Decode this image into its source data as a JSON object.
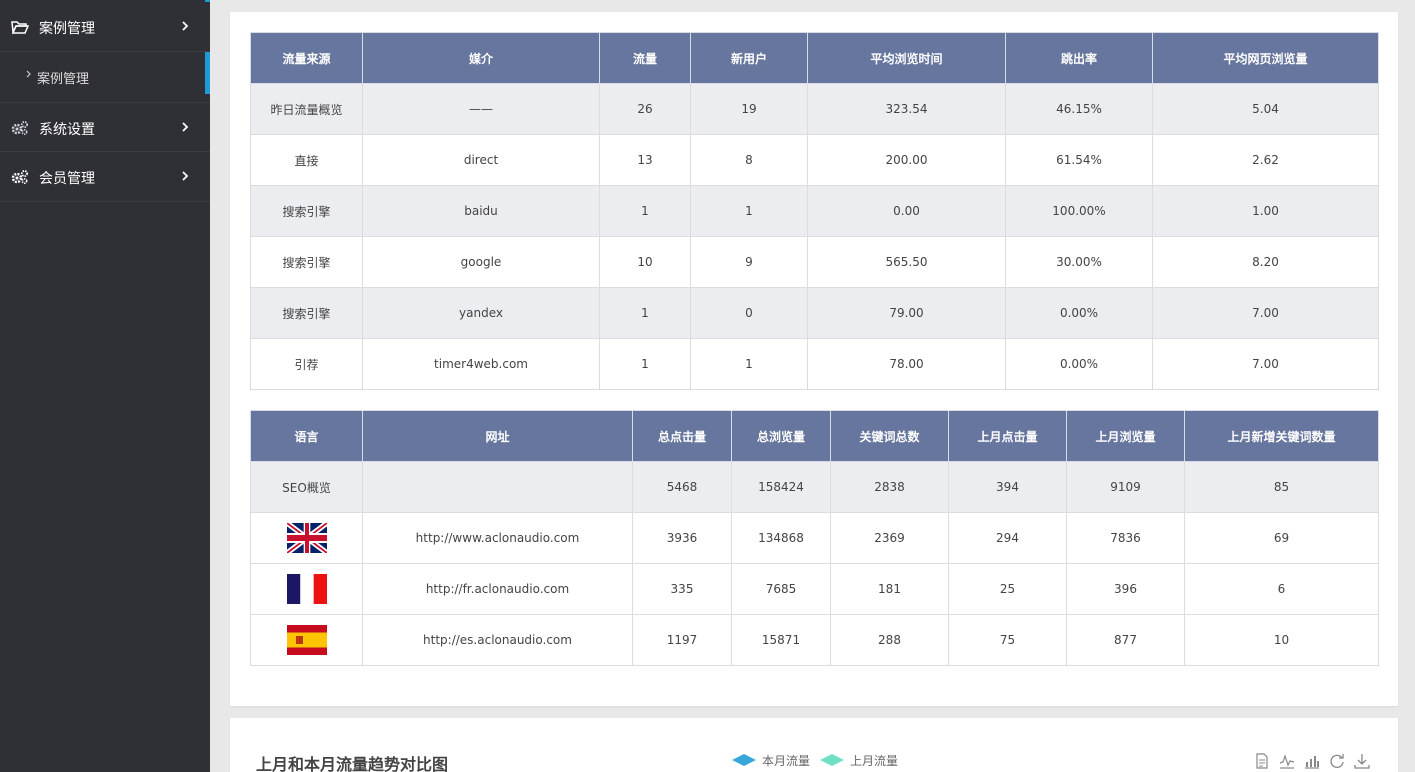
{
  "sidebar": {
    "items": [
      {
        "label": "案例管理",
        "icon": "folder-open-icon"
      },
      {
        "label": "系统设置",
        "icon": "gears-icon"
      },
      {
        "label": "会员管理",
        "icon": "gears-icon"
      }
    ],
    "sub_items": [
      {
        "label": "案例管理"
      }
    ]
  },
  "traffic_table": {
    "headers": [
      "流量来源",
      "媒介",
      "流量",
      "新用户",
      "平均浏览时间",
      "跳出率",
      "平均网页浏览量"
    ],
    "rows": [
      [
        "昨日流量概览",
        "——",
        "26",
        "19",
        "323.54",
        "46.15%",
        "5.04"
      ],
      [
        "直接",
        "direct",
        "13",
        "8",
        "200.00",
        "61.54%",
        "2.62"
      ],
      [
        "搜索引擎",
        "baidu",
        "1",
        "1",
        "0.00",
        "100.00%",
        "1.00"
      ],
      [
        "搜索引擎",
        "google",
        "10",
        "9",
        "565.50",
        "30.00%",
        "8.20"
      ],
      [
        "搜索引擎",
        "yandex",
        "1",
        "0",
        "79.00",
        "0.00%",
        "7.00"
      ],
      [
        "引荐",
        "timer4web.com",
        "1",
        "1",
        "78.00",
        "0.00%",
        "7.00"
      ]
    ]
  },
  "seo_table": {
    "headers": [
      "语言",
      "网址",
      "总点击量",
      "总浏览量",
      "关键词总数",
      "上月点击量",
      "上月浏览量",
      "上月新增关键词数量"
    ],
    "summary": [
      "SEO概览",
      "",
      "5468",
      "158424",
      "2838",
      "394",
      "9109",
      "85"
    ],
    "rows": [
      {
        "flag": "uk-flag-icon",
        "cells": [
          "http://www.aclonaudio.com",
          "3936",
          "134868",
          "2369",
          "294",
          "7836",
          "69"
        ]
      },
      {
        "flag": "france-flag-icon",
        "cells": [
          "http://fr.aclonaudio.com",
          "335",
          "7685",
          "181",
          "25",
          "396",
          "6"
        ]
      },
      {
        "flag": "spain-flag-icon",
        "cells": [
          "http://es.aclonaudio.com",
          "1197",
          "15871",
          "288",
          "75",
          "877",
          "10"
        ]
      }
    ]
  },
  "chart": {
    "title": "上月和本月流量趋势对比图",
    "legend": [
      {
        "label": "本月流量",
        "color": "#3aa7dc"
      },
      {
        "label": "上月流量",
        "color": "#6fe0c4"
      }
    ],
    "toolbox": [
      "data-view-icon",
      "line-chart-icon",
      "bar-chart-icon",
      "restore-icon",
      "save-image-icon"
    ]
  }
}
